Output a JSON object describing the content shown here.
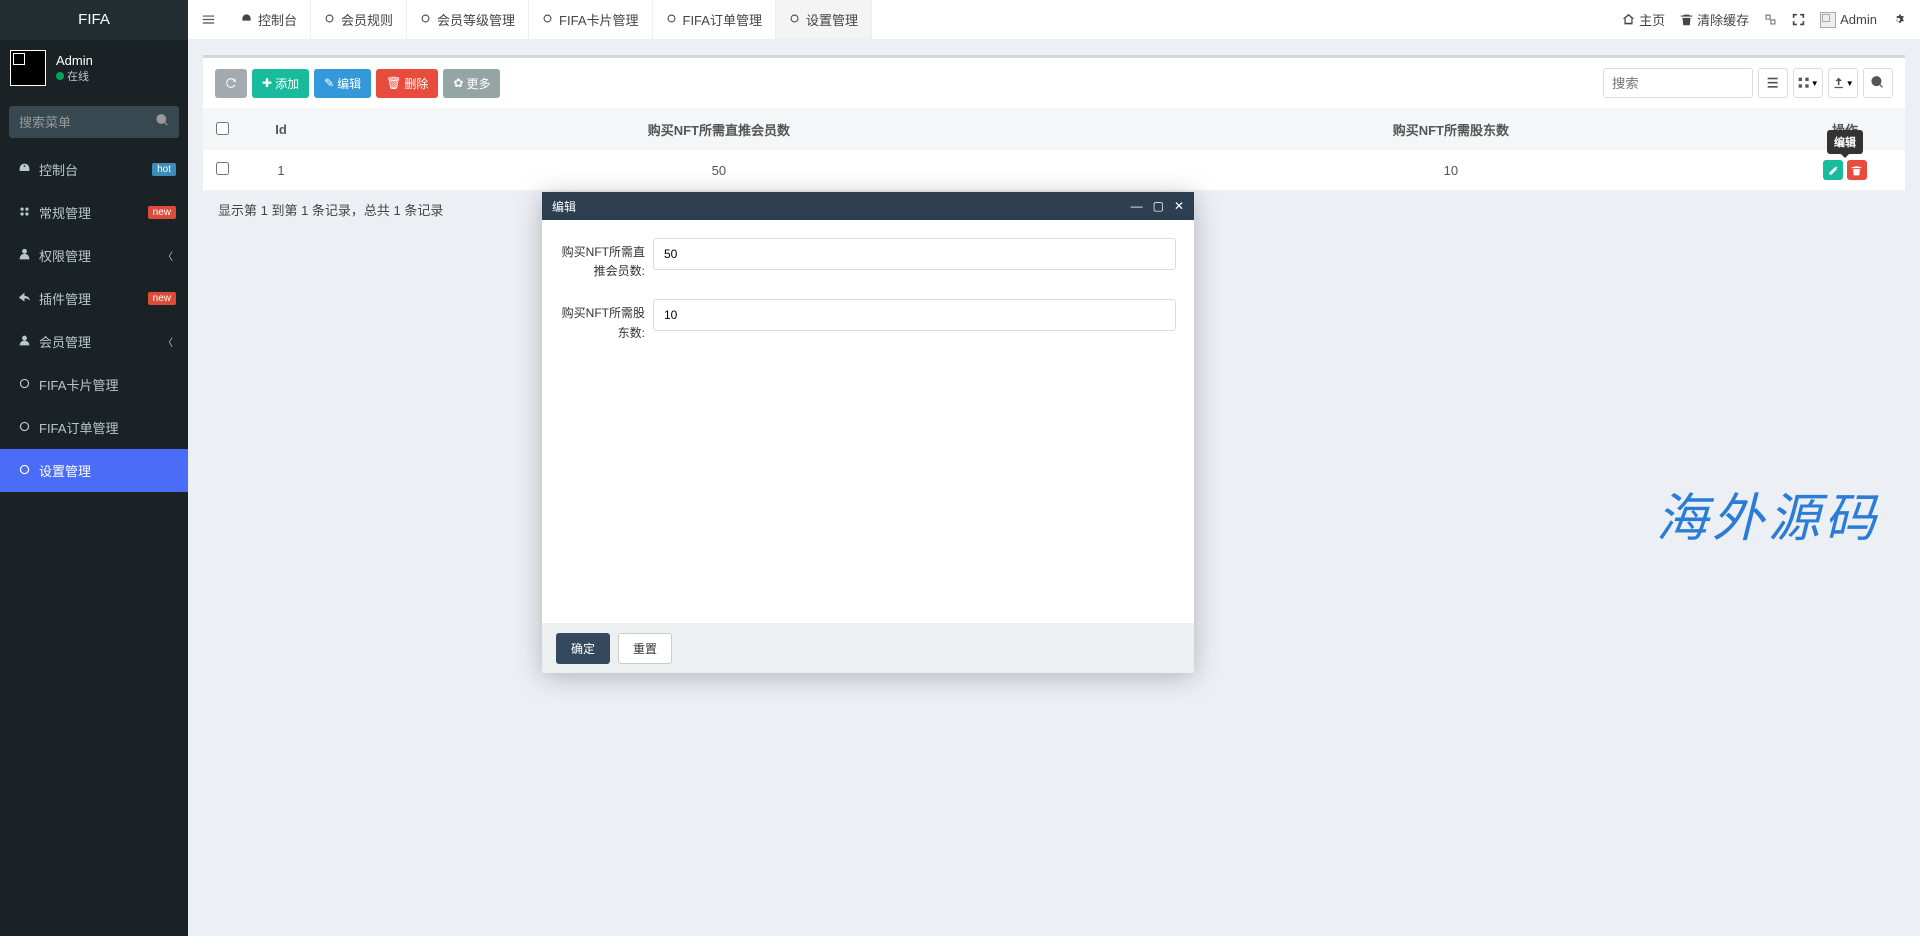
{
  "brand": "FIFA",
  "user": {
    "name": "Admin",
    "status": "在线"
  },
  "sidebar": {
    "search_placeholder": "搜索菜单",
    "items": [
      {
        "label": "控制台",
        "badge": "hot",
        "badge_cls": "hot"
      },
      {
        "label": "常规管理",
        "badge": "new",
        "badge_cls": "new",
        "arrow": true
      },
      {
        "label": "权限管理",
        "arrow": true
      },
      {
        "label": "插件管理",
        "badge": "new",
        "badge_cls": "new",
        "arrow": true
      },
      {
        "label": "会员管理",
        "arrow": true
      },
      {
        "label": "FIFA卡片管理"
      },
      {
        "label": "FIFA订单管理"
      },
      {
        "label": "设置管理",
        "active": true
      }
    ]
  },
  "topbar": {
    "tabs": [
      {
        "label": "控制台",
        "icon": "dash"
      },
      {
        "label": "会员规则",
        "icon": "circ"
      },
      {
        "label": "会员等级管理",
        "icon": "circ"
      },
      {
        "label": "FIFA卡片管理",
        "icon": "circ"
      },
      {
        "label": "FIFA订单管理",
        "icon": "circ"
      },
      {
        "label": "设置管理",
        "icon": "circ",
        "current": true
      }
    ],
    "right": {
      "home": "主页",
      "clear_cache": "清除缓存",
      "admin": "Admin"
    }
  },
  "toolbar": {
    "add": "添加",
    "edit": "编辑",
    "delete": "删除",
    "more": "更多",
    "search_placeholder": "搜索"
  },
  "table": {
    "headers": [
      "Id",
      "购买NFT所需直推会员数",
      "购买NFT所需股东数",
      "操作"
    ],
    "rows": [
      {
        "id": "1",
        "members": "50",
        "shareholders": "10"
      }
    ],
    "footer": "显示第 1 到第 1 条记录，总共 1 条记录"
  },
  "tooltip": "编辑",
  "modal": {
    "title": "编辑",
    "field1_label": "购买NFT所需直推会员数:",
    "field1_value": "50",
    "field2_label": "购买NFT所需股东数:",
    "field2_value": "10",
    "submit": "确定",
    "reset": "重置"
  },
  "watermark": "海外源码"
}
